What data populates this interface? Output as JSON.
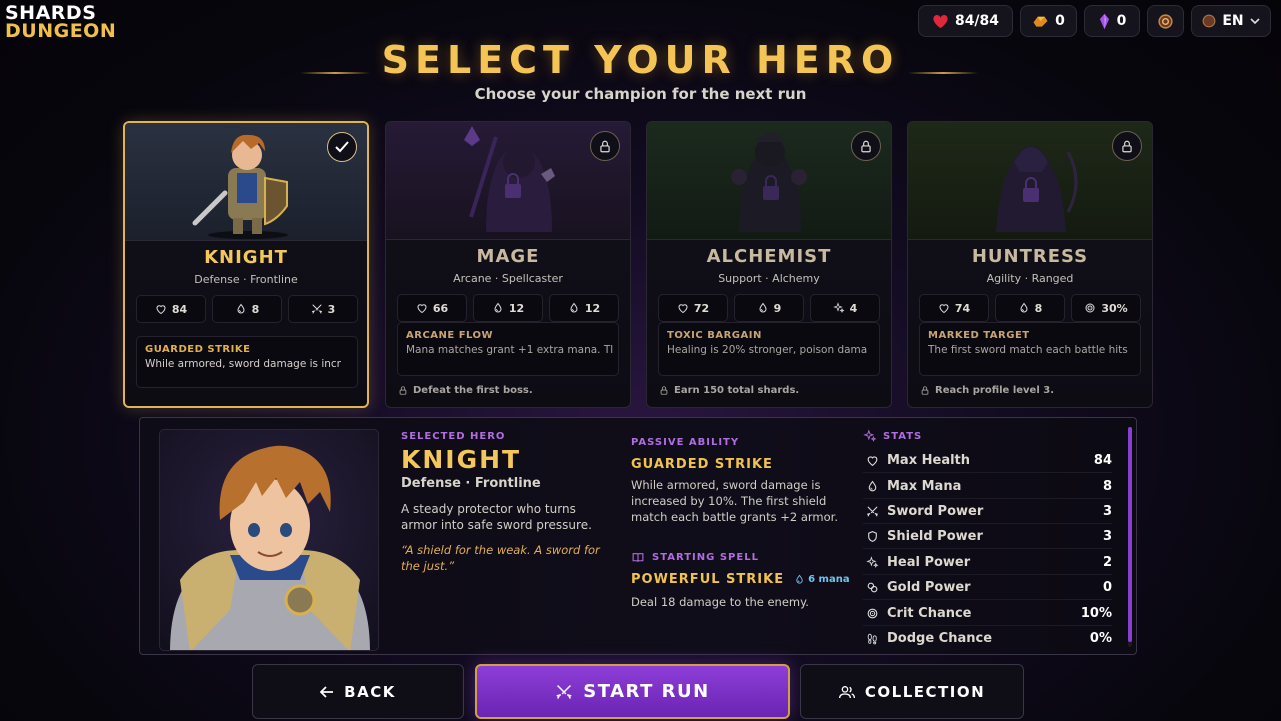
{
  "logo": {
    "line1": "SHARDS",
    "line2": "DUNGEON"
  },
  "topbar": {
    "health": "84/84",
    "gold": "0",
    "shards": "0",
    "settings_icon": "gear-icon",
    "language": "EN"
  },
  "title": "SELECT YOUR HERO",
  "subtitle": "Choose your champion for the next run",
  "heroes": [
    {
      "name": "KNIGHT",
      "role": "Defense · Frontline",
      "selected": true,
      "stats": [
        {
          "icon": "heart-icon",
          "value": "84"
        },
        {
          "icon": "mana-drop-icon",
          "value": "8"
        },
        {
          "icon": "crossed-swords-icon",
          "value": "3"
        }
      ],
      "ability_name": "GUARDED STRIKE",
      "ability_desc": "While armored, sword damage is incr",
      "lock_text": ""
    },
    {
      "name": "MAGE",
      "role": "Arcane · Spellcaster",
      "selected": false,
      "stats": [
        {
          "icon": "heart-icon",
          "value": "66"
        },
        {
          "icon": "mana-drop-icon",
          "value": "12"
        },
        {
          "icon": "mana-drop-icon",
          "value": "12"
        }
      ],
      "ability_name": "ARCANE FLOW",
      "ability_desc": "Mana matches grant +1 extra mana. Tl",
      "lock_text": "Defeat the first boss."
    },
    {
      "name": "ALCHEMIST",
      "role": "Support · Alchemy",
      "selected": false,
      "stats": [
        {
          "icon": "heart-icon",
          "value": "72"
        },
        {
          "icon": "mana-drop-icon",
          "value": "9"
        },
        {
          "icon": "sparkle-icon",
          "value": "4"
        }
      ],
      "ability_name": "TOXIC BARGAIN",
      "ability_desc": "Healing is 20% stronger, poison dama",
      "lock_text": "Earn 150 total shards."
    },
    {
      "name": "HUNTRESS",
      "role": "Agility · Ranged",
      "selected": false,
      "stats": [
        {
          "icon": "heart-icon",
          "value": "74"
        },
        {
          "icon": "mana-drop-icon",
          "value": "8"
        },
        {
          "icon": "target-icon",
          "value": "30%"
        }
      ],
      "ability_name": "MARKED TARGET",
      "ability_desc": "The first sword match each battle hits",
      "lock_text": "Reach profile level 3."
    }
  ],
  "detail": {
    "label": "SELECTED HERO",
    "name": "KNIGHT",
    "role": "Defense · Frontline",
    "description": "A steady protector who turns armor into safe sword pressure.",
    "quote": "“A shield for the weak. A sword for the just.”",
    "passive_label": "PASSIVE ABILITY",
    "passive_name": "GUARDED STRIKE",
    "passive_desc": "While armored, sword damage is increased by 10%. The first shield match each battle grants +2 armor.",
    "spell_label": "STARTING SPELL",
    "spell_name": "POWERFUL STRIKE",
    "spell_cost": "6 mana",
    "spell_desc": "Deal 18 damage to the enemy.",
    "stats_label": "STATS",
    "stats": [
      {
        "icon": "heart-icon",
        "label": "Max Health",
        "value": "84"
      },
      {
        "icon": "mana-drop-icon",
        "label": "Max Mana",
        "value": "8"
      },
      {
        "icon": "crossed-swords-icon",
        "label": "Sword Power",
        "value": "3"
      },
      {
        "icon": "shield-icon",
        "label": "Shield Power",
        "value": "3"
      },
      {
        "icon": "sparkle-icon",
        "label": "Heal Power",
        "value": "2"
      },
      {
        "icon": "coins-icon",
        "label": "Gold Power",
        "value": "0"
      },
      {
        "icon": "target-icon",
        "label": "Crit Chance",
        "value": "10%"
      },
      {
        "icon": "footprints-icon",
        "label": "Dodge Chance",
        "value": "0%"
      }
    ]
  },
  "buttons": {
    "back": "BACK",
    "start": "START RUN",
    "collection": "COLLECTION"
  },
  "colors": {
    "gold": "#f3c75a",
    "purple": "#8e3ed8",
    "panel": "#0e0c16"
  }
}
